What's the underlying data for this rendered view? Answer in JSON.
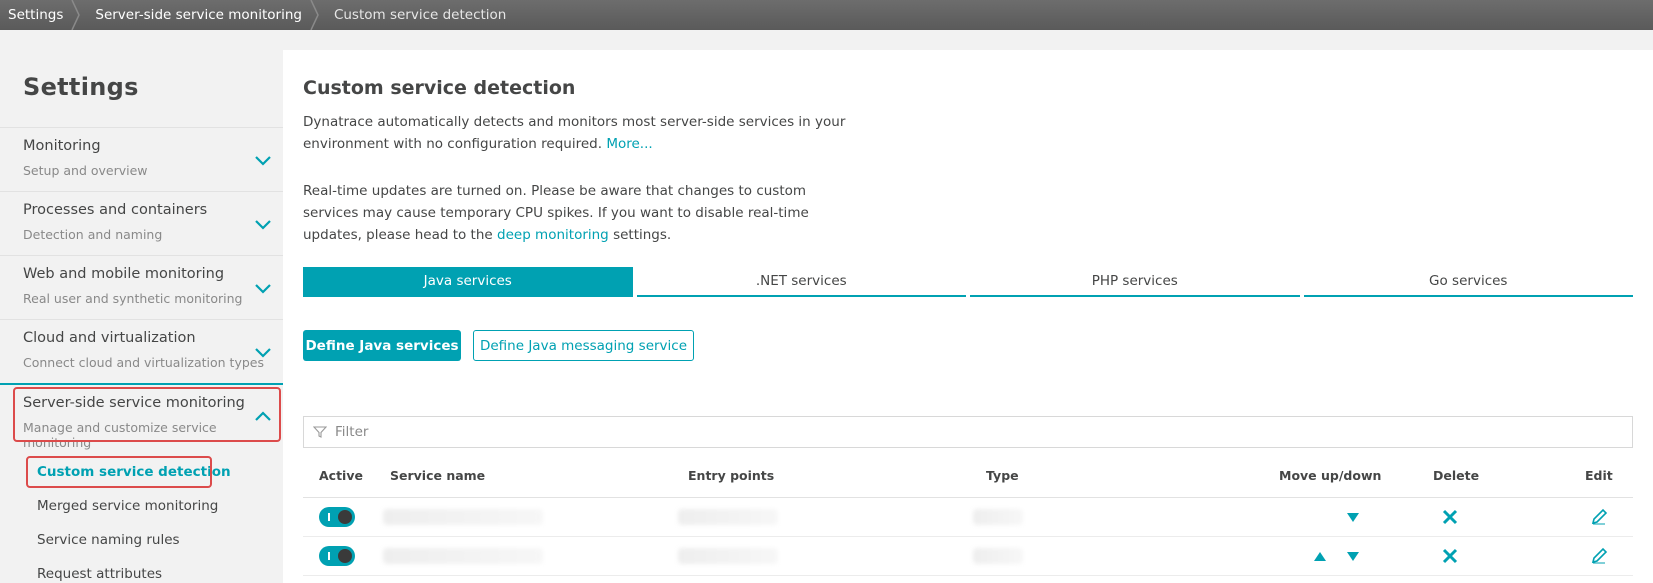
{
  "breadcrumb": [
    "Settings",
    "Server-side service monitoring",
    "Custom service detection"
  ],
  "sidebar": {
    "title": "Settings",
    "items": [
      {
        "title": "Monitoring",
        "sub": "Setup and overview"
      },
      {
        "title": "Processes and containers",
        "sub": "Detection and naming"
      },
      {
        "title": "Web and mobile monitoring",
        "sub": "Real user and synthetic monitoring"
      },
      {
        "title": "Cloud and virtualization",
        "sub": "Connect cloud and virtualization types"
      },
      {
        "title": "Server-side service monitoring",
        "sub": "Manage and customize service monitoring"
      }
    ],
    "subitems": [
      "Custom service detection",
      "Merged service monitoring",
      "Service naming rules",
      "Request attributes"
    ]
  },
  "main": {
    "title": "Custom service detection",
    "intro": "Dynatrace automatically detects and monitors most server-side services in your environment with no configuration required.",
    "more_link": "More...",
    "realtime_text": "Real-time updates are turned on. Please be aware that changes to custom services may cause temporary CPU spikes. If you want to disable real-time updates, please head to the",
    "deep_link": "deep monitoring",
    "realtime_suffix": "settings.",
    "tabs": [
      "Java services",
      ".NET services",
      "PHP services",
      "Go services"
    ],
    "define_button": "Define Java services",
    "messaging_button": "Define Java messaging service",
    "filter_placeholder": "Filter",
    "columns": {
      "active": "Active",
      "service_name": "Service name",
      "entry_points": "Entry points",
      "type": "Type",
      "move": "Move up/down",
      "delete": "Delete",
      "edit": "Edit"
    }
  },
  "colors": {
    "accent": "#00a1b2",
    "highlight": "#dc4b4b"
  }
}
